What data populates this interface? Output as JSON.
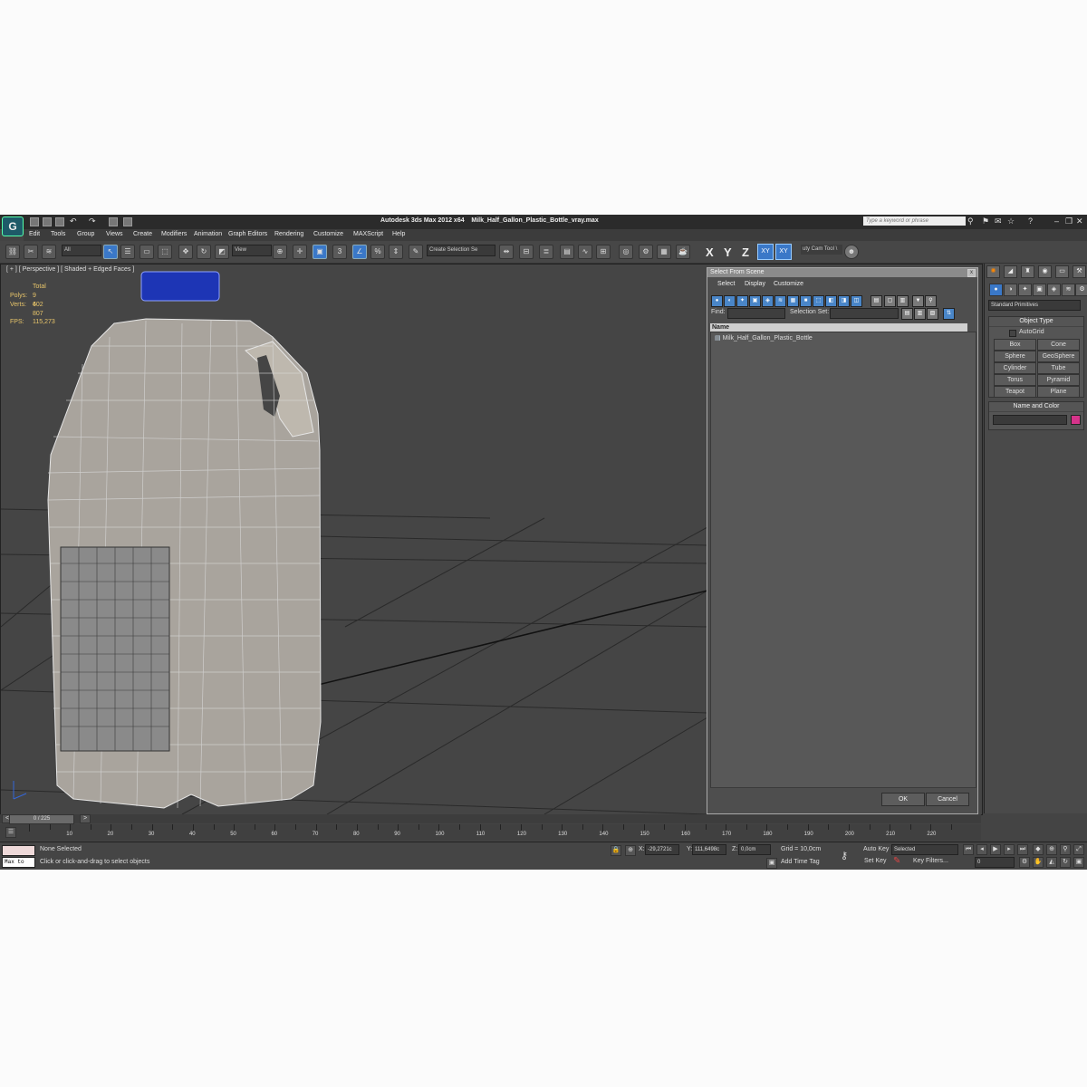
{
  "titlebar": {
    "app_title": "Autodesk 3ds Max  2012 x64",
    "file_name": "Milk_Half_Gallon_Plastic_Bottle_vray.max",
    "search_placeholder": "Type a keyword or phrase"
  },
  "menu": [
    "Edit",
    "Tools",
    "Group",
    "Views",
    "Create",
    "Modifiers",
    "Animation",
    "Graph Editors",
    "Rendering",
    "Customize",
    "MAXScript",
    "Help"
  ],
  "toolbar": {
    "filter_value": "All",
    "view_value": "View",
    "snap_label": "3",
    "selection_set_value": "Create Selection Se",
    "axes": [
      "X",
      "Y",
      "Z",
      "XY",
      "XY"
    ],
    "cam_tool_label": "uty Cam Tool \\"
  },
  "viewport": {
    "label": "[ + ] [ Perspective ] [ Shaded + Edged Faces ]",
    "stats": {
      "total_label": "Total",
      "polys_label": "Polys:",
      "polys_value": "9 602",
      "verts_label": "Verts:",
      "verts_value": "4 807",
      "fps_label": "FPS:",
      "fps_value": "115,273"
    }
  },
  "dialog": {
    "title": "Select From Scene",
    "menu": [
      "Select",
      "Display",
      "Customize"
    ],
    "find_label": "Find:",
    "selection_set_label": "Selection Set:",
    "column_name": "Name",
    "items": [
      "Milk_Half_Gallon_Plastic_Bottle"
    ],
    "ok_label": "OK",
    "cancel_label": "Cancel"
  },
  "command_panel": {
    "category_value": "Standard Primitives",
    "object_type_header": "Object Type",
    "autogrid_label": "AutoGrid",
    "primitives": [
      "Box",
      "Cone",
      "Sphere",
      "GeoSphere",
      "Cylinder",
      "Tube",
      "Torus",
      "Pyramid",
      "Teapot",
      "Plane"
    ],
    "name_color_header": "Name and Color",
    "swatch_color": "#d6338a"
  },
  "timeline": {
    "position": "0 / 225",
    "ticks": [
      10,
      20,
      30,
      40,
      50,
      60,
      70,
      80,
      90,
      100,
      110,
      120,
      130,
      140,
      150,
      160,
      170,
      180,
      190,
      200,
      210,
      220
    ]
  },
  "status": {
    "maxscript_label": "Max to",
    "selection_text": "None Selected",
    "prompt_text": "Click or click-and-drag to select objects",
    "x_label": "X:",
    "x_value": "-29,2721c",
    "y_label": "Y:",
    "y_value": "111,6498c",
    "z_label": "Z:",
    "z_value": "0,0cm",
    "grid_text": "Grid = 10,0cm",
    "add_time_tag": "Add Time Tag",
    "auto_key": "Auto Key",
    "auto_key_value": "Selected",
    "set_key": "Set Key",
    "key_filters": "Key Filters...",
    "frame_value": "0"
  }
}
